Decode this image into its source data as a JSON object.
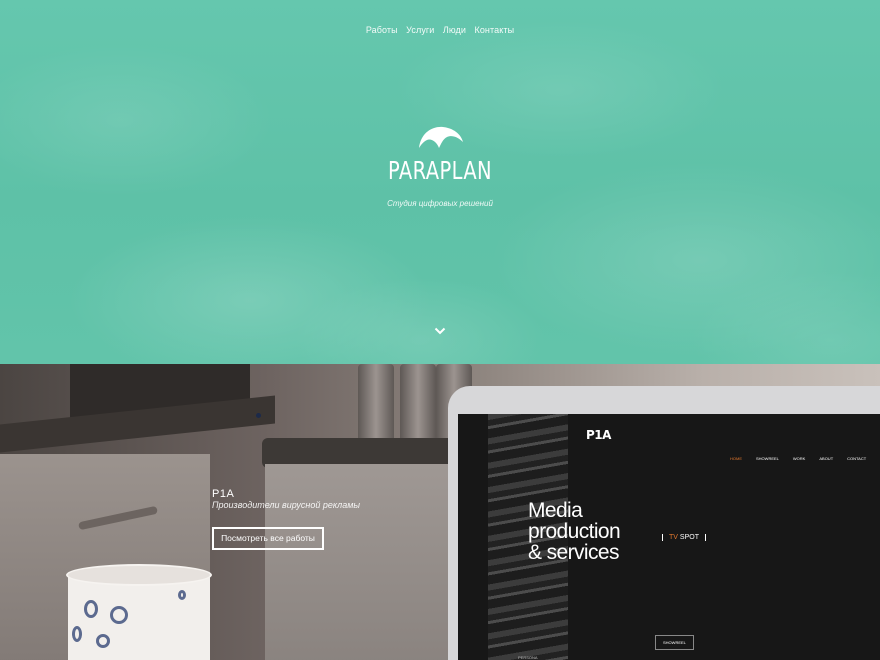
{
  "nav": {
    "items": [
      {
        "label": "Работы"
      },
      {
        "label": "Услуги"
      },
      {
        "label": "Люди"
      },
      {
        "label": "Контакты"
      }
    ]
  },
  "hero": {
    "logo_icon": "paraglider-logo-icon",
    "brand": "PARAPLAN",
    "tagline": "Студия цифровых решений",
    "scroll_icon": "chevron-down-icon",
    "background_color": "#62c4aa"
  },
  "project": {
    "title": "P1A",
    "subtitle": "Производители вирусной рекламы",
    "button_label": "Посмотреть все работы",
    "screen": {
      "logo": "P1A",
      "nav": [
        "HOME",
        "SHOWREEL",
        "WORK",
        "ABOUT",
        "CONTACT"
      ],
      "headline": [
        "Media",
        "production",
        "& services"
      ],
      "tv_label": "TV",
      "spot_label": "SPOT",
      "showreel_button": "SHOWREEL",
      "bottom_text": "PERSONA",
      "accent_color": "#e2782e"
    }
  }
}
